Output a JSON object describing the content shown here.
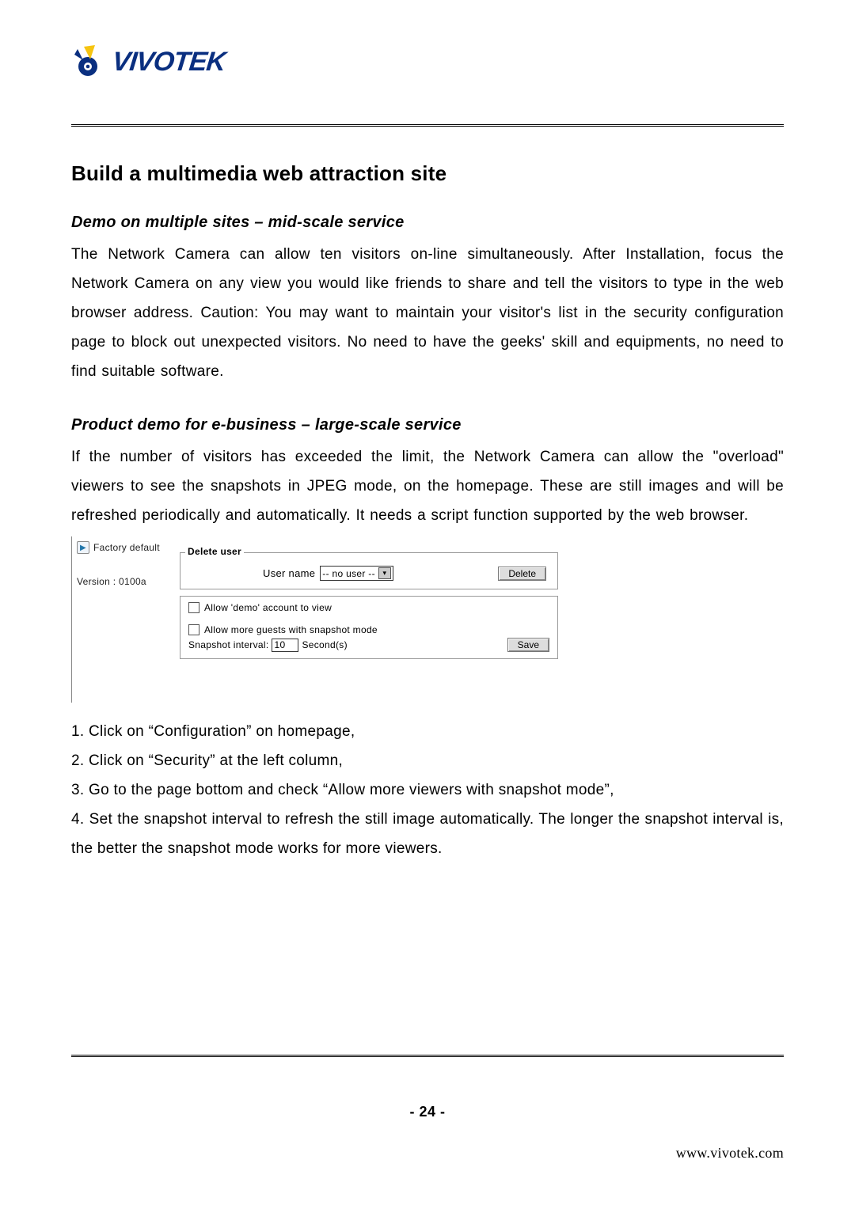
{
  "brand": {
    "name": "VIVOTEK"
  },
  "page_title": "Build a multimedia web attraction site",
  "section1": {
    "heading": "Demo on multiple sites – mid-scale service",
    "body": "The Network Camera can allow ten visitors on-line simultaneously. After Installation, focus the Network Camera on any view you would like friends to share and tell the visitors to type in the web browser address. Caution:   You may want to maintain your visitor's list in the security configuration page to block out unexpected visitors. No need to have the geeks' skill and equipments, no need to find suitable software."
  },
  "section2": {
    "heading": "Product demo for e-business – large-scale service",
    "body": "If the number of visitors has exceeded the limit, the Network Camera can allow the \"overload\" viewers to see the snapshots in JPEG mode, on the homepage.   These are still images and will be refreshed periodically and automatically.  It needs a script function supported by the web browser."
  },
  "panel": {
    "sidebar": {
      "factory_default": "Factory default",
      "version_label": "Version : 0100a"
    },
    "delete_user_legend": "Delete user",
    "user_name_label": "User name",
    "user_name_value": "-- no user --",
    "delete_button": "Delete",
    "allow_demo_label": "Allow 'demo' account to view",
    "allow_more_label": "Allow more guests with snapshot mode",
    "snapshot_label_prefix": "Snapshot interval:",
    "snapshot_value": "10",
    "snapshot_unit": "Second(s)",
    "save_button": "Save"
  },
  "steps": {
    "s1": "1. Click on “Configuration” on homepage,",
    "s2": "2. Click on “Security” at the left column,",
    "s3": "3. Go to the page bottom and check “Allow more viewers with snapshot mode”,",
    "s4": "4. Set the snapshot interval to refresh the still image automatically. The longer the snapshot interval is, the better the snapshot mode works for more viewers."
  },
  "footer": {
    "page_number": "- 24 -",
    "url": "www.vivotek.com"
  }
}
